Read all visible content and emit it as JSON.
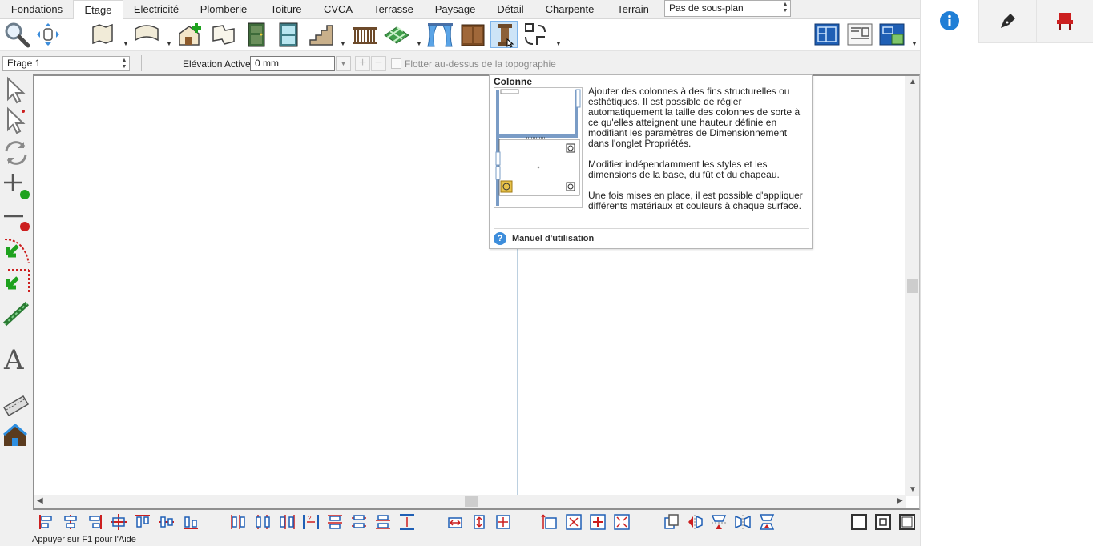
{
  "tabs": [
    {
      "label": "Fondations",
      "active": false
    },
    {
      "label": "Etage",
      "active": true
    },
    {
      "label": "Electricité",
      "active": false
    },
    {
      "label": "Plomberie",
      "active": false
    },
    {
      "label": "Toiture",
      "active": false
    },
    {
      "label": "CVCA",
      "active": false
    },
    {
      "label": "Terrasse",
      "active": false
    },
    {
      "label": "Paysage",
      "active": false
    },
    {
      "label": "Détail",
      "active": false
    },
    {
      "label": "Charpente",
      "active": false
    },
    {
      "label": "Terrain",
      "active": false
    }
  ],
  "plan_select": {
    "value": "Pas de sous-plan"
  },
  "propsbar": {
    "floor_value": "Etage 1",
    "elevation_label": "Elévation Active:",
    "elevation_value": "0 mm",
    "float_label": "Flotter au-dessus de la topographie",
    "float_checked": false
  },
  "toolbar": {
    "tools": [
      "zoom-tool",
      "pan-tool",
      "wall-tool",
      "curved-wall-tool",
      "room-tool",
      "floor-plan-tool",
      "door-tool",
      "window-tool",
      "stairs-tool",
      "railing-tool",
      "flooring-tool",
      "curtain-tool",
      "cabinet-tool",
      "column-tool",
      "shape-tool"
    ],
    "pressed": "column-tool"
  },
  "tooltip": {
    "title": "Colonne",
    "paragraphs": [
      "Ajouter des colonnes à des fins structurelles ou esthétiques. Il est possible de régler automatiquement la taille des colonnes de sorte à ce qu'elles atteignent une hauteur définie en modifiant les paramètres de Dimensionnement dans l'onglet Propriétés.",
      "Modifier indépendamment les styles et les dimensions de la base, du fût et du chapeau.",
      "Une fois mises en place, il est possible d'appliquer différents matériaux et couleurs à chaque surface."
    ],
    "help_link": "Manuel d'utilisation"
  },
  "status": {
    "text": "Appuyer sur F1 pour l'Aide"
  },
  "colors": {
    "accent": "#3d8ddb",
    "pressed": "#cde4f7",
    "tool_red": "#cc1f1f",
    "tool_green": "#1ea21e"
  }
}
